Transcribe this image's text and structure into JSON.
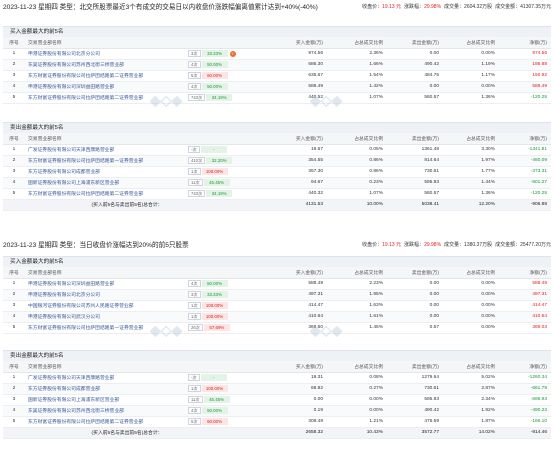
{
  "headers": {
    "cols_buy": [
      "序号",
      "交易营业部名称",
      "",
      "买入金额(万)",
      "占总成交比例",
      "卖出金额(万)",
      "占总成交比例",
      "净额(万)"
    ],
    "cols_sell": [
      "序号",
      "交易营业部名称",
      "",
      "买入金额(万)",
      "占总成交比例",
      "卖出金额(万)",
      "占总成交比例",
      "净额(万)"
    ]
  },
  "block1": {
    "title": "2023-11-23 星期四 类型：北交所股票最近3个有成交的交易日以内收盘价涨跌幅偏离值累计达到+40%(-40%)",
    "stats": [
      {
        "label": "收盘价：",
        "value": "19.13 元",
        "color": "red"
      },
      {
        "label": "涨跌幅：",
        "value": "29.98%",
        "color": "red"
      },
      {
        "label": "成交量：",
        "value": "2604.32万股",
        "color": ""
      },
      {
        "label": "成交金额：",
        "value": "41307.35万元",
        "color": ""
      }
    ],
    "buy_title": "买入金额最大的前5名",
    "buy_rows": [
      {
        "no": "1",
        "name": "申港证券股份有限公司北京分公司",
        "tag": "3次",
        "rate": "33.33%",
        "rc": "g",
        "icon": true,
        "buy": "974.56",
        "bp": "2.36%",
        "sell": "0.00",
        "sp": "0.00%",
        "net": "974.56"
      },
      {
        "no": "2",
        "name": "东吴证券股份有限公司苏州西北街三桥营业部",
        "tag": "4次",
        "rate": "50.00%",
        "rc": "g",
        "icon": false,
        "buy": "686.30",
        "bp": "1.66%",
        "sell": "490.42",
        "sp": "1.19%",
        "net": "195.88"
      },
      {
        "no": "3",
        "name": "东方财富证券股份有限公司拉萨团结路第二证券营业部",
        "tag": "5次",
        "rate": "60.00%",
        "rc": "r",
        "icon": false,
        "buy": "635.67",
        "bp": "1.54%",
        "sell": "484.75",
        "sp": "1.17%",
        "net": "150.92"
      },
      {
        "no": "4",
        "name": "申港证券股份有限公司深圳益田路营业部",
        "tag": "4次",
        "rate": "50.00%",
        "rc": "g",
        "icon": false,
        "buy": "588.49",
        "bp": "1.42%",
        "sell": "0.00",
        "sp": "0.00%",
        "net": "588.49"
      },
      {
        "no": "5",
        "name": "东方财富证券股份有限公司拉萨团结路第二证券营业部",
        "tag": "743次",
        "rate": "34.19%",
        "rc": "g",
        "icon": false,
        "buy": "440.52",
        "bp": "1.07%",
        "sell": "560.57",
        "sp": "1.36%",
        "net": "-120.25"
      }
    ],
    "sell_title": "卖出金额最大的前5名",
    "sell_rows": [
      {
        "no": "1",
        "name": "广发证券股份有限公司天津西康路营业部",
        "tag": "-次",
        "rate": "-",
        "rc": "g",
        "icon": false,
        "buy": "19.67",
        "bp": "0.05%",
        "sell": "1361.48",
        "sp": "3.30%",
        "net": "-1341.81"
      },
      {
        "no": "2",
        "name": "东方财富证券股份有限公司拉萨团结路第一证券营业部",
        "tag": "410次",
        "rate": "32.20%",
        "rc": "g",
        "icon": false,
        "buy": "354.55",
        "bp": "0.86%",
        "sell": "814.64",
        "sp": "1.97%",
        "net": "-460.09"
      },
      {
        "no": "3",
        "name": "东方证券股份有限公司成都营业部",
        "tag": "1次",
        "rate": "100.00%",
        "rc": "r",
        "icon": false,
        "buy": "357.30",
        "bp": "0.86%",
        "sell": "730.61",
        "sp": "1.77%",
        "net": "-373.31"
      },
      {
        "no": "4",
        "name": "国新证券股份有限公司上海浦东新区营业部",
        "tag": "11次",
        "rate": "45.45%",
        "rc": "g",
        "icon": false,
        "buy": "94.67",
        "bp": "0.23%",
        "sell": "595.93",
        "sp": "1.44%",
        "net": "-501.27"
      },
      {
        "no": "5",
        "name": "东方财富证券股份有限公司拉萨团结路第二证券营业部",
        "tag": "743次",
        "rate": "34.19%",
        "rc": "g",
        "icon": false,
        "buy": "440.32",
        "bp": "1.07%",
        "sell": "560.57",
        "sp": "1.36%",
        "net": "-120.25"
      }
    ],
    "sum": {
      "label": "(买入前5名与卖出前5名)总合计：",
      "buy": "4131.53",
      "bp": "10.00%",
      "sell": "5038.41",
      "sp": "12.20%",
      "net": "-906.88"
    }
  },
  "block2": {
    "title": "2023-11-23 星期四 类型：当日收盘价涨幅达到20%的前5只股票",
    "stats": [
      {
        "label": "收盘价：",
        "value": "19.13 元",
        "color": "red"
      },
      {
        "label": "涨跌幅：",
        "value": "29.98%",
        "color": "red"
      },
      {
        "label": "成交量：",
        "value": "1380.37万股",
        "color": ""
      },
      {
        "label": "成交金额：",
        "value": "25477.20万元",
        "color": ""
      }
    ],
    "buy_title": "买入金额最大的前5名",
    "buy_rows": [
      {
        "no": "1",
        "name": "申港证券股份有限公司深圳益田路营业部",
        "tag": "4次",
        "rate": "50.00%",
        "rc": "g",
        "icon": false,
        "buy": "588.49",
        "bp": "2.23%",
        "sell": "0.00",
        "sp": "0.00%",
        "net": "588.49"
      },
      {
        "no": "2",
        "name": "申港证券股份有限公司北京分公司",
        "tag": "3次",
        "rate": "33.33%",
        "rc": "g",
        "icon": false,
        "buy": "497.31",
        "bp": "1.95%",
        "sell": "0.00",
        "sp": "0.00%",
        "net": "497.31"
      },
      {
        "no": "3",
        "name": "中国银河证券股份有限公司苏州人民路证券营业部",
        "tag": "1次",
        "rate": "100.00%",
        "rc": "r",
        "icon": false,
        "buy": "414.47",
        "bp": "1.63%",
        "sell": "0.00",
        "sp": "0.00%",
        "net": "414.47"
      },
      {
        "no": "4",
        "name": "申港证券股份有限公司武汉分公司",
        "tag": "1次",
        "rate": "100.00%",
        "rc": "r",
        "icon": false,
        "buy": "410.64",
        "bp": "1.61%",
        "sell": "0.00",
        "sp": "0.00%",
        "net": "410.64"
      },
      {
        "no": "5",
        "name": "东方财富证券股份有限公司拉萨团结路第一证券营业部",
        "tag": "26次",
        "rate": "57.69%",
        "rc": "r",
        "icon": false,
        "buy": "369.60",
        "bp": "1.45%",
        "sell": "0.57",
        "sp": "0.00%",
        "net": "369.03"
      }
    ],
    "sell_title": "卖出金额最大的前5名",
    "sell_rows": [
      {
        "no": "1",
        "name": "广发证券股份有限公司天津西康路营业部",
        "tag": "-次",
        "rate": "-",
        "rc": "g",
        "icon": false,
        "buy": "19.31",
        "bp": "0.08%",
        "sell": "1279.64",
        "sp": "5.02%",
        "net": "-1260.34"
      },
      {
        "no": "2",
        "name": "东方证券股份有限公司成都营业部",
        "tag": "1次",
        "rate": "100.00%",
        "rc": "r",
        "icon": false,
        "buy": "68.82",
        "bp": "0.27%",
        "sell": "730.61",
        "sp": "2.87%",
        "net": "-661.79"
      },
      {
        "no": "3",
        "name": "国新证券股份有限公司上海浦东新区营业部",
        "tag": "11次",
        "rate": "45.45%",
        "rc": "g",
        "icon": false,
        "buy": "0.00",
        "bp": "0.00%",
        "sell": "595.93",
        "sp": "2.34%",
        "net": "-595.93"
      },
      {
        "no": "4",
        "name": "东吴证券股份有限公司苏州西北街三桥营业部",
        "tag": "4次",
        "rate": "50.00%",
        "rc": "g",
        "icon": false,
        "buy": "0.19",
        "bp": "0.00%",
        "sell": "490.42",
        "sp": "1.92%",
        "net": "-490.23"
      },
      {
        "no": "5",
        "name": "东方财富证券股份有限公司拉萨团结路第二证券营业部",
        "tag": "5次",
        "rate": "60.00%",
        "rc": "r",
        "icon": false,
        "buy": "309.49",
        "bp": "1.21%",
        "sell": "475.59",
        "sp": "1.87%",
        "net": "-166.10"
      }
    ],
    "sum": {
      "label": "(买入前5名与卖出前5名)总合计：",
      "buy": "2658.32",
      "bp": "10.43%",
      "sell": "3572.77",
      "sp": "14.02%",
      "net": "-914.46"
    }
  }
}
